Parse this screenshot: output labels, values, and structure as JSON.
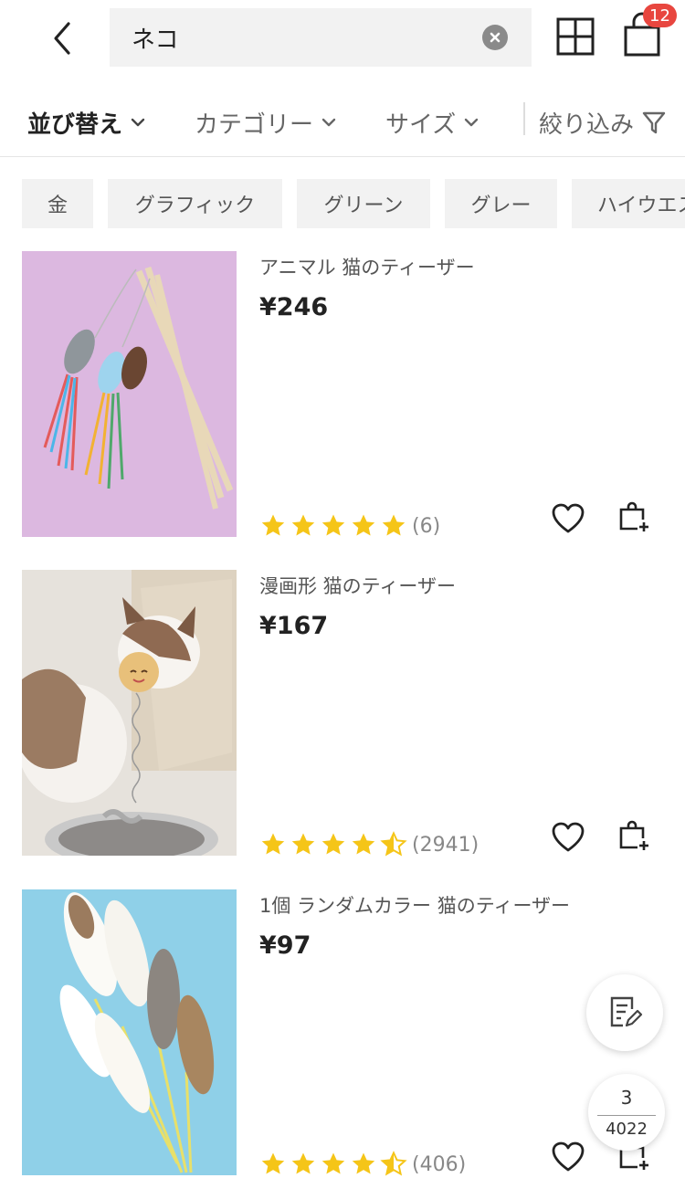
{
  "header": {
    "search_value": "ネコ",
    "cart_count": "12"
  },
  "filters": {
    "sort": "並び替え",
    "category": "カテゴリー",
    "size": "サイズ",
    "refine": "絞り込み"
  },
  "chips": [
    "金",
    "グラフィック",
    "グリーン",
    "グレー",
    "ハイウエスト"
  ],
  "products": [
    {
      "title": "アニマル 猫のティーザー",
      "price": "¥246",
      "rating": 5,
      "rating_count": "(6)"
    },
    {
      "title": "漫画形 猫のティーザー",
      "price": "¥167",
      "rating": 4.5,
      "rating_count": "(2941)"
    },
    {
      "title": "1個 ランダムカラー 猫のティーザー",
      "price": "¥97",
      "rating": 4.5,
      "rating_count": "(406)"
    }
  ],
  "pager": {
    "current": "3",
    "total": "4022"
  },
  "colors": {
    "accent": "#e8463f",
    "star": "#f5c518",
    "chip_bg": "#f2f2f2"
  }
}
